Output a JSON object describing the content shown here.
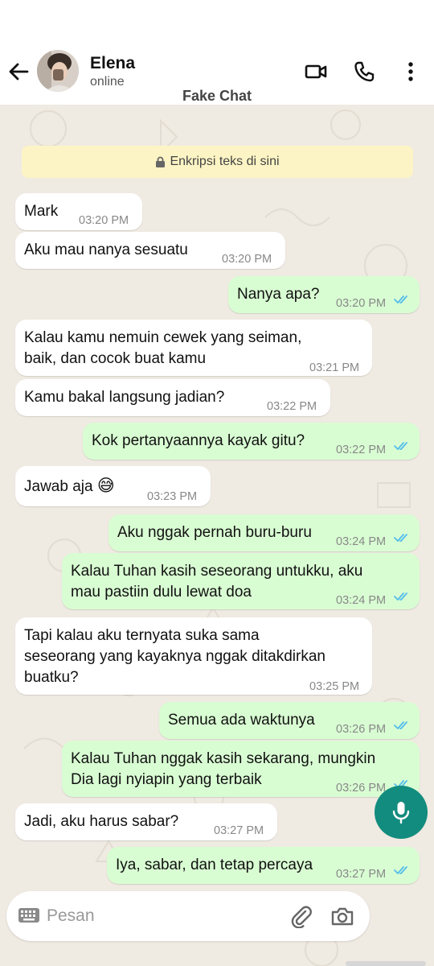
{
  "header": {
    "contact_name": "Elena",
    "contact_status": "online",
    "watermark": "Fake Chat"
  },
  "encryption_notice": "Enkripsi teks di sini",
  "messages": [
    {
      "direction": "in",
      "lines": [
        "Mark"
      ],
      "time": "03:20 PM"
    },
    {
      "direction": "in",
      "lines": [
        "Aku mau nanya sesuatu"
      ],
      "time": "03:20 PM"
    },
    {
      "direction": "out",
      "lines": [
        "Nanya apa?"
      ],
      "time": "03:20 PM",
      "read": true
    },
    {
      "direction": "in",
      "lines": [
        "Kalau kamu nemuin cewek yang seiman,",
        "baik, dan cocok buat kamu"
      ],
      "time": "03:21 PM"
    },
    {
      "direction": "in",
      "lines": [
        "Kamu bakal langsung jadian?"
      ],
      "time": "03:22 PM"
    },
    {
      "direction": "out",
      "lines": [
        "Kok pertanyaannya kayak gitu?"
      ],
      "time": "03:22 PM",
      "read": true
    },
    {
      "direction": "in",
      "lines": [
        "Jawab aja"
      ],
      "emoji": "😅",
      "time": "03:23 PM"
    },
    {
      "direction": "out",
      "lines": [
        "Aku nggak pernah buru-buru"
      ],
      "time": "03:24 PM",
      "read": true
    },
    {
      "direction": "out",
      "lines": [
        "Kalau Tuhan kasih seseorang untukku, aku",
        "mau pastiin dulu lewat doa"
      ],
      "time": "03:24 PM",
      "read": true
    },
    {
      "direction": "in",
      "lines": [
        "Tapi kalau aku ternyata suka sama",
        "seseorang yang kayaknya nggak ditakdirkan",
        "buatku?"
      ],
      "time": "03:25 PM"
    },
    {
      "direction": "out",
      "lines": [
        "Semua ada waktunya"
      ],
      "time": "03:26 PM",
      "read": true
    },
    {
      "direction": "out",
      "lines": [
        "Kalau Tuhan nggak kasih sekarang, mungkin",
        "Dia lagi nyiapin yang terbaik"
      ],
      "time": "03:26 PM",
      "read": true
    },
    {
      "direction": "in",
      "lines": [
        "Jadi, aku harus sabar?"
      ],
      "time": "03:27 PM"
    },
    {
      "direction": "out",
      "lines": [
        "Iya, sabar, dan tetap percaya"
      ],
      "time": "03:27 PM",
      "read": true
    }
  ],
  "composer": {
    "placeholder": "Pesan",
    "value": ""
  },
  "icons": {
    "back": "arrow-left-icon",
    "video": "video-camera-icon",
    "call": "phone-icon",
    "menu": "more-vertical-icon",
    "keyboard": "keyboard-icon",
    "attach": "paperclip-icon",
    "camera": "camera-icon",
    "mic": "microphone-icon",
    "lock": "lock-icon"
  },
  "colors": {
    "chat_background": "#efeae2",
    "incoming_bubble": "#ffffff",
    "outgoing_bubble": "#d9fdd3",
    "read_ticks": "#53bdeb",
    "encryption_banner": "#fcf4c4",
    "mic_button": "#128c7e"
  }
}
